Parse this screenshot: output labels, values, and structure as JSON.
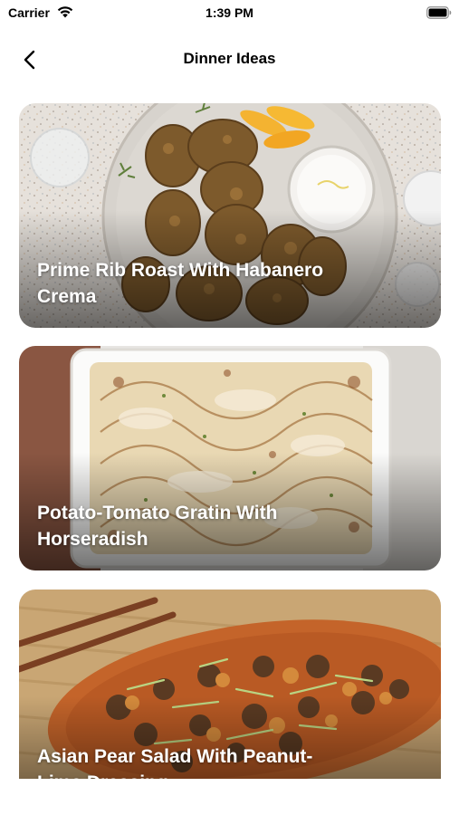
{
  "status_bar": {
    "carrier": "Carrier",
    "time": "1:39 PM",
    "wifi_icon": "wifi-icon",
    "battery_icon": "battery-icon"
  },
  "nav": {
    "back_icon": "chevron-left-icon",
    "title": "Dinner Ideas"
  },
  "recipes": [
    {
      "title": "Prime Rib Roast With Habanero Crema"
    },
    {
      "title": "Potato-Tomato Gratin With Horseradish"
    },
    {
      "title": "Asian Pear Salad With Peanut-Lime Dressing"
    }
  ],
  "colors": {
    "text": "#000000",
    "card_title": "#ffffff",
    "background": "#ffffff"
  }
}
